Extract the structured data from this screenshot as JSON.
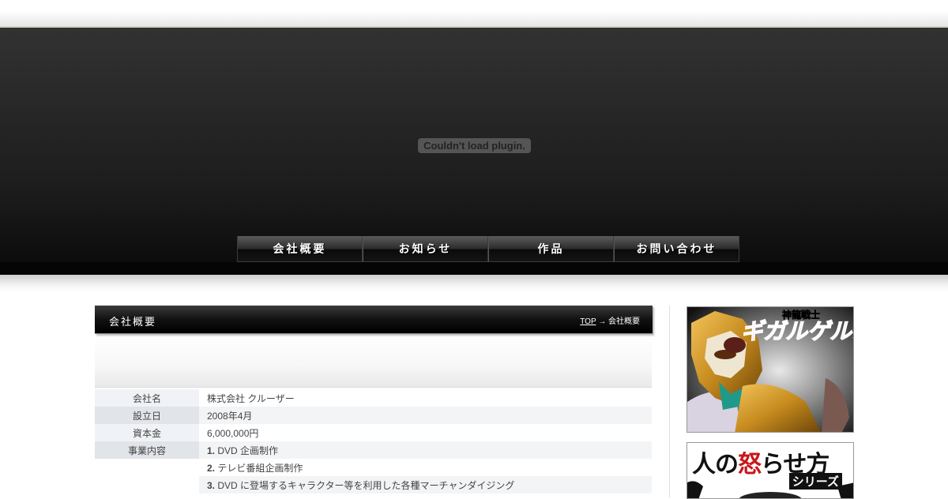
{
  "header": {
    "plugin_message": "Couldn't load plugin."
  },
  "nav": {
    "items": [
      {
        "label": "会社概要"
      },
      {
        "label": "お知らせ"
      },
      {
        "label": "作品"
      },
      {
        "label": "お問い合わせ"
      }
    ]
  },
  "page": {
    "title": "会社概要",
    "breadcrumb": {
      "top_link": "TOP",
      "separator": "→",
      "current": "会社概要"
    }
  },
  "company_info": {
    "rows": [
      {
        "label": "会社名",
        "value": "株式会社 クルーザー"
      },
      {
        "label": "設立日",
        "value": "2008年4月"
      },
      {
        "label": "資本金",
        "value": "6,000,000円"
      },
      {
        "label": "事業内容",
        "num": "1.",
        "value": "DVD 企画制作"
      },
      {
        "label": "",
        "num": "2.",
        "value": "テレビ番組企画制作"
      },
      {
        "label": "",
        "num": "3.",
        "value": "DVD に登場するキャラクター等を利用した各種マーチャンダイジング"
      }
    ]
  },
  "sidebar": {
    "banner1": {
      "title_text": "神龍戦士 ギガルゲルス"
    },
    "banner2": {
      "title_part1": "人の",
      "title_red": "怒",
      "title_part2": "らせ方",
      "subtitle": "シリーズ"
    }
  },
  "colors": {
    "accent_red": "#c8171a",
    "header_dark": "#1c1c1c"
  }
}
